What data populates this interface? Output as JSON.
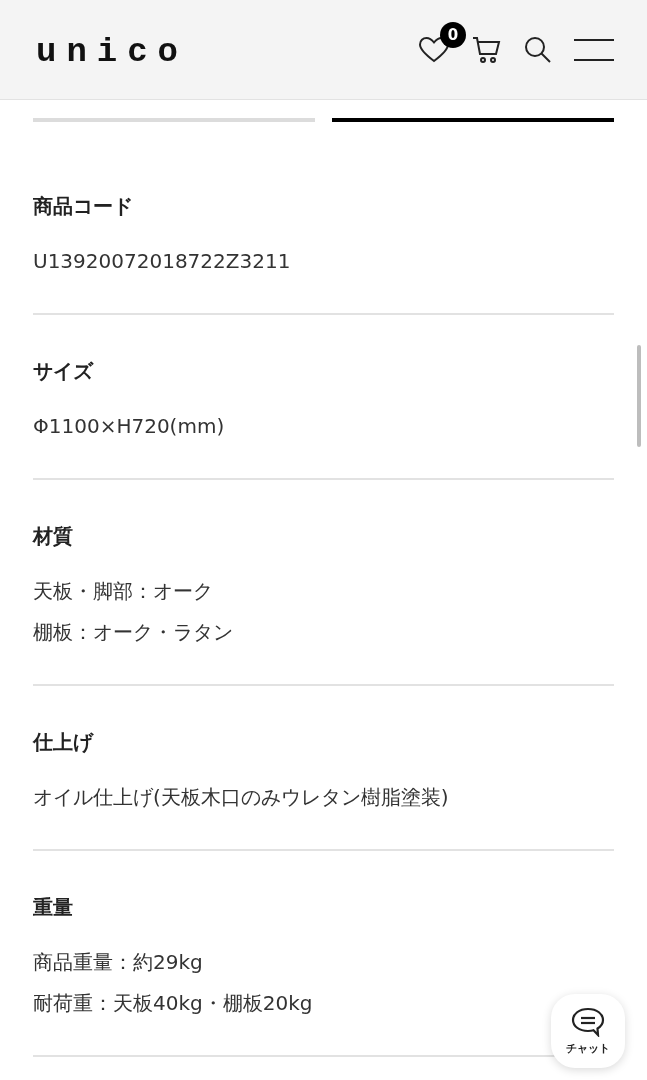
{
  "header": {
    "logo": "unico",
    "favorites_count": "0"
  },
  "tabs": [
    {
      "selected": false
    },
    {
      "selected": true
    }
  ],
  "specs": [
    {
      "label": "商品コード",
      "lines": [
        "U13920072018722Z3211"
      ]
    },
    {
      "label": "サイズ",
      "lines": [
        "Φ1100×H720(mm)"
      ]
    },
    {
      "label": "材質",
      "lines": [
        "天板・脚部：オーク",
        "棚板：オーク・ラタン"
      ]
    },
    {
      "label": "仕上げ",
      "lines": [
        "オイル仕上げ(天板木口のみウレタン樹脂塗装)"
      ]
    },
    {
      "label": "重量",
      "lines": [
        "商品重量：約29kg",
        "耐荷重：天板40kg・棚板20kg"
      ]
    }
  ],
  "chat_button": {
    "label": "チャット"
  }
}
